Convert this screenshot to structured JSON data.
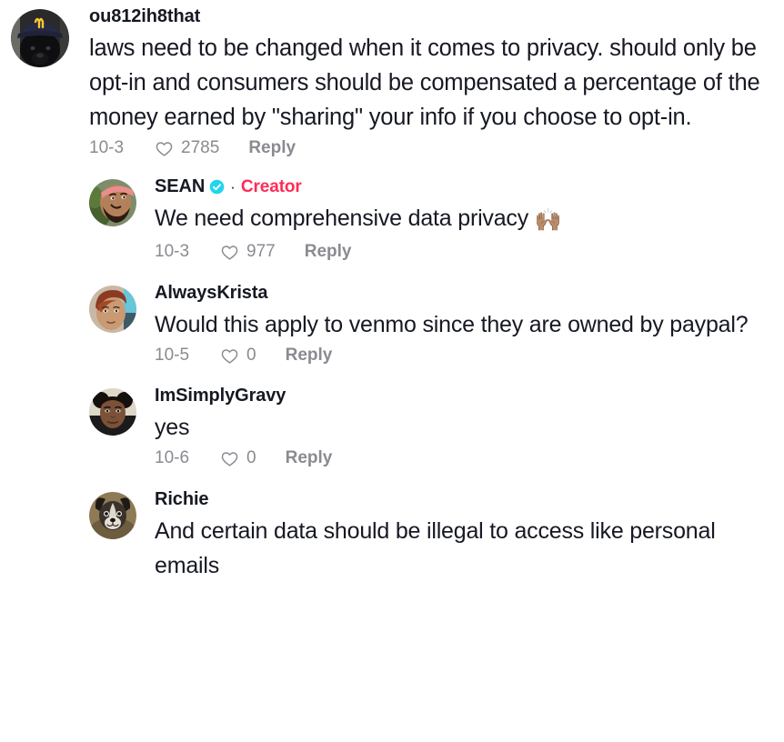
{
  "thread": {
    "comments": [
      {
        "id": "root",
        "username": "ou812ih8that",
        "verified": false,
        "is_creator": false,
        "text": "laws need to be changed when it comes to privacy. should only be opt-in and consumers should be compensated a percentage of the money earned by \"sharing\" your info if you choose to opt-in.",
        "date": "10-3",
        "likes": "2785",
        "reply_label": "Reply",
        "avatar_name": "avatar-black-dog-mcdonalds-cap"
      },
      {
        "id": "reply-1",
        "username": "SEAN",
        "verified": true,
        "is_creator": true,
        "creator_label": "Creator",
        "separator": "·",
        "text": "We need comprehensive data privacy ",
        "emoji": "🙌🏽",
        "date": "10-3",
        "likes": "977",
        "reply_label": "Reply",
        "avatar_name": "avatar-man-pink-headband"
      },
      {
        "id": "reply-2",
        "username": "AlwaysKrista",
        "verified": false,
        "is_creator": false,
        "text": "Would this apply to venmo since they are owned by paypal?",
        "date": "10-5",
        "likes": "0",
        "reply_label": "Reply",
        "avatar_name": "avatar-woman-red-hair"
      },
      {
        "id": "reply-3",
        "username": "ImSimplyGravy",
        "verified": false,
        "is_creator": false,
        "text": "yes",
        "date": "10-6",
        "likes": "0",
        "reply_label": "Reply",
        "avatar_name": "avatar-woman-puff-buns"
      },
      {
        "id": "reply-4",
        "username": "Richie",
        "verified": false,
        "is_creator": false,
        "text": "And certain data should be illegal to access like personal emails",
        "date": "",
        "likes": "",
        "reply_label": "",
        "avatar_name": "avatar-chihuahua-dog"
      }
    ]
  },
  "colors": {
    "text": "#161823",
    "muted": "#8a8b91",
    "creator_pink": "#FE2C55",
    "verified_cyan": "#20D5EC",
    "background": "#FFFFFF"
  },
  "icons": {
    "heart": "heart-outline-icon",
    "verified": "verified-badge-icon"
  }
}
